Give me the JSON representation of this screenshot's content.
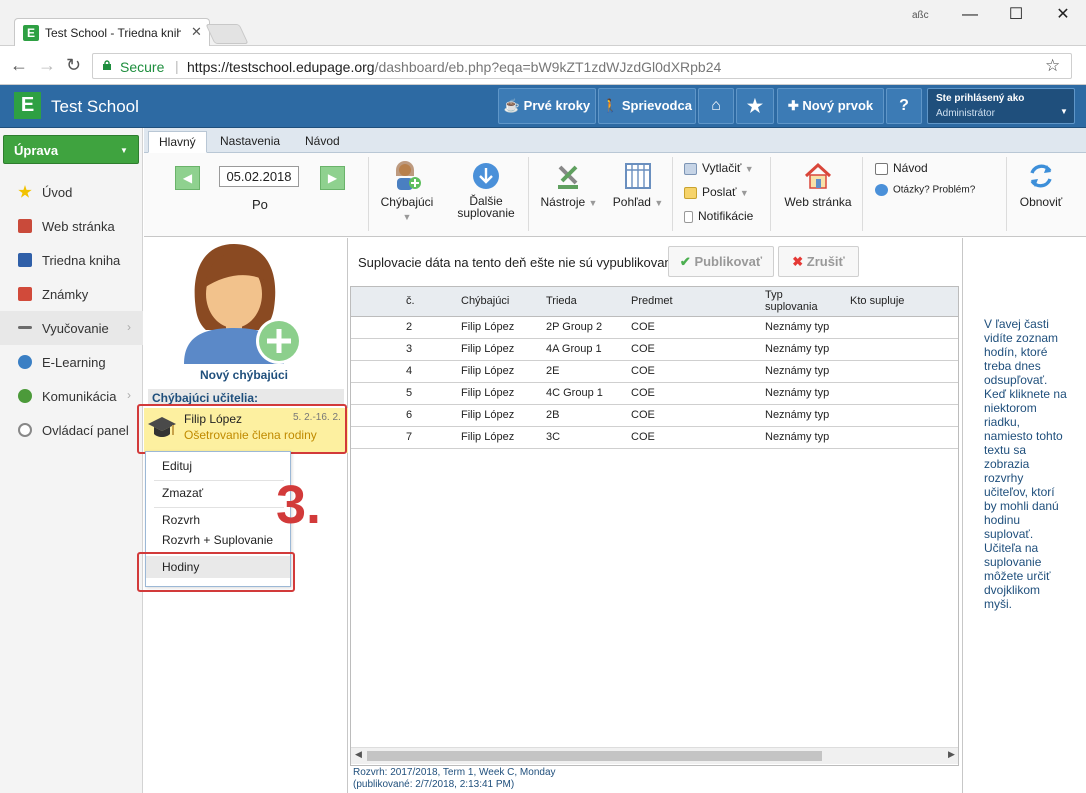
{
  "browser": {
    "tab_title": "Test School - Triedna knih",
    "favicon_letter": "E",
    "window_user_badge": "aßc",
    "secure_label": "Secure",
    "url_host": "https://testschool.edupage.org",
    "url_path": "/dashboard/eb.php?eqa=bW9kZT1zdWJzdGl0dXRpb24"
  },
  "header": {
    "logo_letter": "E",
    "school_name": "Test School",
    "buttons": {
      "first_steps": "Prvé kroky",
      "guide": "Sprievodca",
      "new_item": "Nový prvok",
      "help": "?"
    },
    "user": {
      "line1": "Ste prihlásený ako",
      "line2": "Administrátor"
    }
  },
  "sidebar": {
    "primary_button": "Úprava",
    "items": [
      {
        "label": "Úvod",
        "icon": "star-icon"
      },
      {
        "label": "Web stránka",
        "icon": "web-icon"
      },
      {
        "label": "Triedna kniha",
        "icon": "book-icon"
      },
      {
        "label": "Známky",
        "icon": "grades-icon"
      },
      {
        "label": "Vyučovanie",
        "icon": "teaching-icon"
      },
      {
        "label": "E-Learning",
        "icon": "globe-icon"
      },
      {
        "label": "Komunikácia",
        "icon": "chat-icon"
      },
      {
        "label": "Ovládací panel",
        "icon": "gear-icon"
      }
    ]
  },
  "ribbon": {
    "tabs": [
      "Hlavný",
      "Nastavenia",
      "Návod"
    ],
    "date": "05.02.2018",
    "day": "Po",
    "absent": "Chýbajúci",
    "next_sub_line1": "Ďalšie",
    "next_sub_line2": "suplovanie",
    "tools": "Nástroje",
    "view": "Pohľad",
    "print": "Vytlačiť",
    "send": "Poslať",
    "notifications": "Notifikácie",
    "website": "Web stránka",
    "manual": "Návod",
    "questions": "Otázky? Problém? N",
    "refresh": "Obnoviť"
  },
  "left_panel": {
    "new_absent": "Nový chýbajúci",
    "absent_header": "Chýbajúci učitelia:",
    "absent_teacher": {
      "name": "Filip López",
      "range": "5. 2.-16. 2.",
      "reason": "Ošetrovanie člena rodiny"
    },
    "context_menu": [
      "Edituj",
      "Zmazať",
      "Rozvrh",
      "Rozvrh + Suplovanie",
      "Hodiny"
    ],
    "step_annotation": "3."
  },
  "center": {
    "notice": "Suplovacie dáta na tento deň ešte nie sú vypublikované.",
    "publish": "Publikovať",
    "cancel": "Zrušiť",
    "columns": [
      "č.",
      "Chýbajúci",
      "Trieda",
      "Predmet",
      "Typ suplovania",
      "Kto supluje"
    ],
    "type_header_line1": "Typ",
    "type_header_line2": "suplovania",
    "rows": [
      {
        "n": "2",
        "absent": "Filip López",
        "class": "2P Group 2",
        "subject": "COE",
        "type": "Neznámy typ",
        "who": ""
      },
      {
        "n": "3",
        "absent": "Filip López",
        "class": "4A Group 1",
        "subject": "COE",
        "type": "Neznámy typ",
        "who": ""
      },
      {
        "n": "4",
        "absent": "Filip López",
        "class": "2E",
        "subject": "COE",
        "type": "Neznámy typ",
        "who": ""
      },
      {
        "n": "5",
        "absent": "Filip López",
        "class": "4C Group 1",
        "subject": "COE",
        "type": "Neznámy typ",
        "who": ""
      },
      {
        "n": "6",
        "absent": "Filip López",
        "class": "2B",
        "subject": "COE",
        "type": "Neznámy typ",
        "who": ""
      },
      {
        "n": "7",
        "absent": "Filip López",
        "class": "3C",
        "subject": "COE",
        "type": "Neznámy typ",
        "who": ""
      }
    ],
    "footer_line1": "Rozvrh: 2017/2018, Term 1, Week C, Monday",
    "footer_line2": "(publikované: 2/7/2018, 2:13:41 PM)"
  },
  "help_panel": {
    "text": "V ľavej časti vidíte zoznam hodín, ktoré treba dnes odsupľovať. Keď kliknete na niektorom riadku, namiesto tohto textu sa zobrazia rozvrhy učiteľov, ktorí by mohli danú hodinu suplovať. Učiteľa na suplovanie môžete určiť dvojklikom myši."
  },
  "colors": {
    "brand_blue": "#2d6aa3",
    "brand_green": "#2ea043",
    "annotation_red": "#d23a3a",
    "selection_yellow": "#fdf0a0"
  }
}
